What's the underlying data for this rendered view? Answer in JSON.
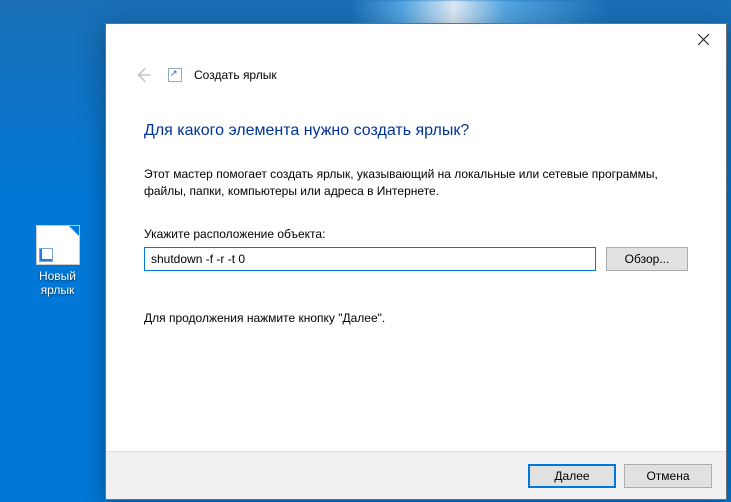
{
  "desktop": {
    "icon_label": "Новый ярлык"
  },
  "dialog": {
    "wizard_name": "Создать ярлык",
    "heading": "Для какого элемента нужно создать ярлык?",
    "description": "Этот мастер помогает создать ярлык, указывающий на локальные или сетевые программы, файлы, папки, компьютеры или адреса в Интернете.",
    "field_label": "Укажите расположение объекта:",
    "location_value": "shutdown -f -r -t 0",
    "browse_label": "Обзор...",
    "continue_hint": "Для продолжения нажмите кнопку \"Далее\".",
    "next_label": "Далее",
    "cancel_label": "Отмена"
  }
}
